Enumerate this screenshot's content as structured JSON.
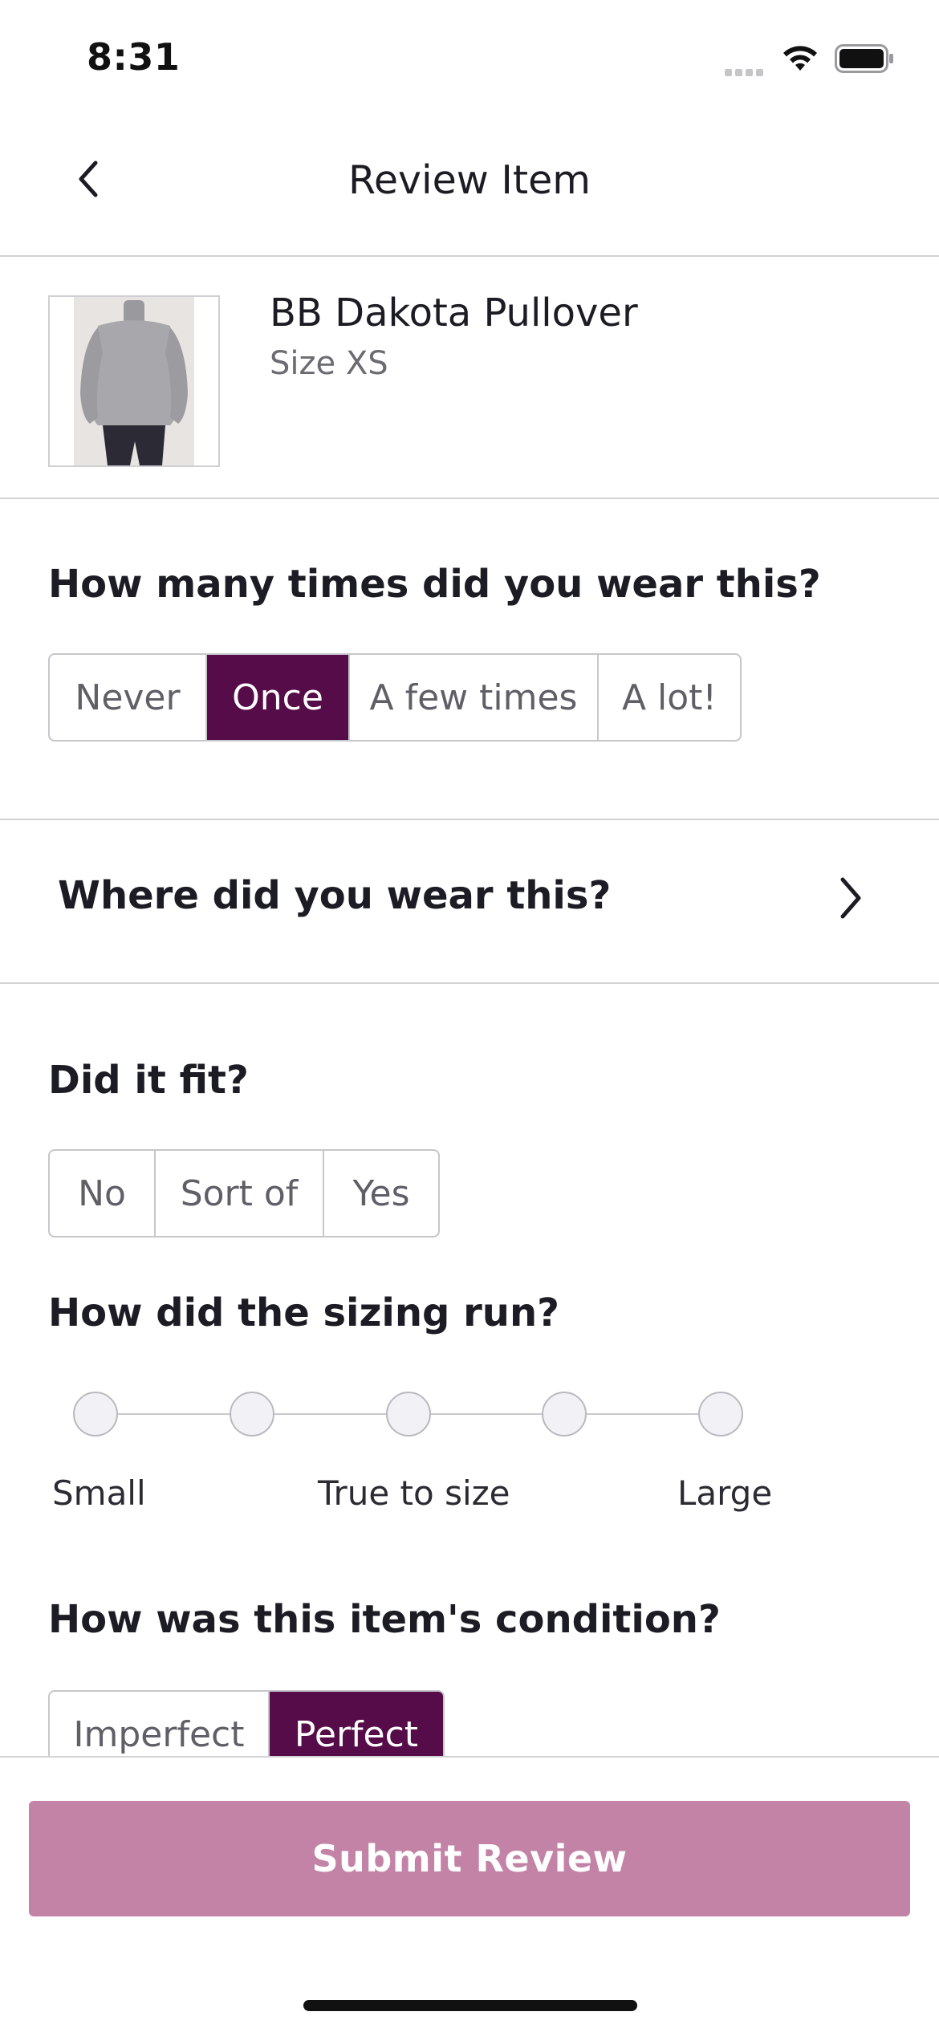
{
  "status_bar": {
    "time": "8:31"
  },
  "nav": {
    "title": "Review Item",
    "back_icon": "chevron-left-icon"
  },
  "product": {
    "name": "BB Dakota Pullover",
    "size": "Size XS",
    "image_icon": "product-photo"
  },
  "wear_count": {
    "question": "How many times did you wear this?",
    "options": [
      "Never",
      "Once",
      "A few times",
      "A lot!"
    ],
    "selected": "Once"
  },
  "where_worn": {
    "label": "Where did you wear this?",
    "icon": "chevron-right-icon"
  },
  "fit": {
    "question": "Did it fit?",
    "options": [
      "No",
      "Sort of",
      "Yes"
    ],
    "selected": null
  },
  "sizing": {
    "question": "How did the sizing run?",
    "steps": 5,
    "labels": {
      "left": "Small",
      "center": "True to size",
      "right": "Large"
    },
    "selected": null
  },
  "condition": {
    "question": "How was this item's condition?",
    "options": [
      "Imperfect",
      "Perfect"
    ],
    "selected": "Perfect"
  },
  "submit": {
    "label": "Submit Review"
  },
  "colors": {
    "accent": "#560c48",
    "submit_disabled": "#c283a7"
  }
}
